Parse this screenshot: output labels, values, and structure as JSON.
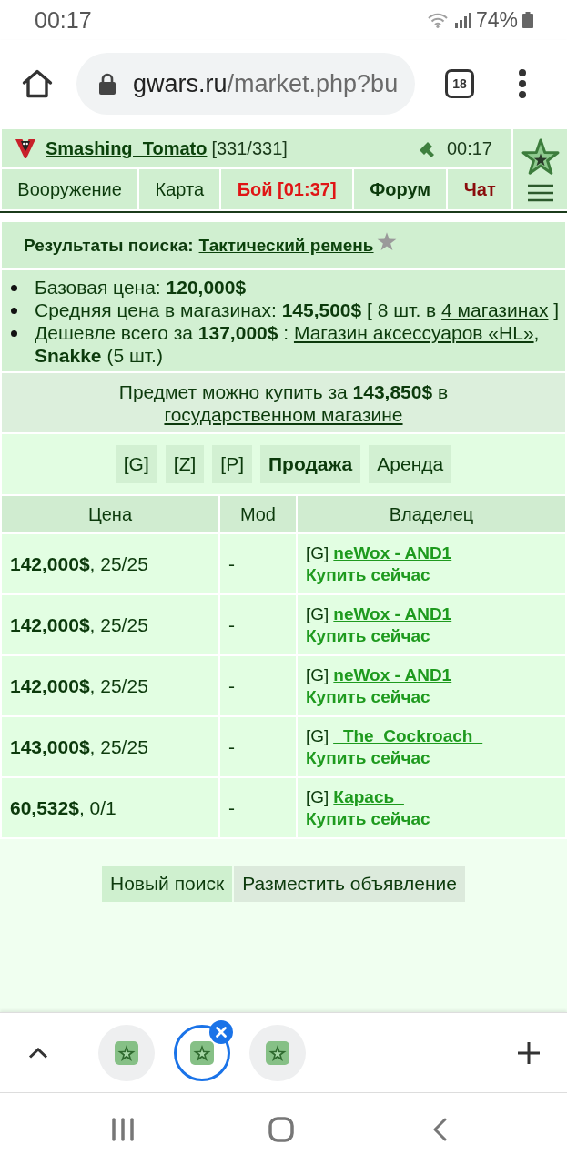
{
  "status_bar": {
    "time": "00:17",
    "battery": "74%"
  },
  "browser": {
    "url_host": "gwars.ru",
    "url_path": "/market.php?bu",
    "tab_count": "18"
  },
  "game_header": {
    "player": "Smashing_Tomato",
    "health": "[331/331]",
    "time": "00:17",
    "nav": [
      {
        "label": "Вооружение",
        "kind": "plain"
      },
      {
        "label": "Карта",
        "kind": "plain"
      },
      {
        "label": "Бой [01:37]",
        "kind": "battle"
      },
      {
        "label": "Форум",
        "kind": "bold"
      },
      {
        "label": "Чат",
        "kind": "chat"
      }
    ]
  },
  "search": {
    "label": "Результаты поиска:",
    "item": "Тактический ремень"
  },
  "info": [
    {
      "parts": [
        {
          "kind": "text",
          "text": "Базовая цена: **120,000$**"
        }
      ]
    },
    {
      "parts": [
        {
          "kind": "text",
          "text": "Средняя цена в магазинах: **145,500$** [ 8 шт. в "
        },
        {
          "kind": "link",
          "text": "4 магазинах"
        },
        {
          "kind": "text",
          "text": " ]"
        }
      ]
    },
    {
      "parts": [
        {
          "kind": "text",
          "text": "Дешевле всего за **137,000$** : "
        },
        {
          "kind": "link",
          "text": "Магазин аксессуаров «HL»"
        },
        {
          "kind": "text",
          "text": ", **Snakke** (5 шт.)"
        }
      ]
    }
  ],
  "offer": {
    "parts": [
      {
        "kind": "text",
        "text": "Предмет можно купить за **143,850$** в "
      },
      {
        "kind": "link",
        "text": "государственном магазине"
      }
    ]
  },
  "filters": [
    {
      "label": "[G]",
      "selected": false
    },
    {
      "label": "[Z]",
      "selected": false
    },
    {
      "label": "[P]",
      "selected": false
    },
    {
      "label": "Продажа",
      "selected": true
    },
    {
      "label": "Аренда",
      "selected": false
    }
  ],
  "table": {
    "columns": [
      "Цена",
      "Mod",
      "Владелец"
    ],
    "rows": [
      {
        "price": "**142,000$**, 25/25",
        "mod": "-",
        "owner_tag": "[G]",
        "owner": "neWox - AND1",
        "action": "Купить сейчас"
      },
      {
        "price": "**142,000$**, 25/25",
        "mod": "-",
        "owner_tag": "[G]",
        "owner": "neWox - AND1",
        "action": "Купить сейчас"
      },
      {
        "price": "**142,000$**, 25/25",
        "mod": "-",
        "owner_tag": "[G]",
        "owner": "neWox - AND1",
        "action": "Купить сейчас"
      },
      {
        "price": "**143,000$**, 25/25",
        "mod": "-",
        "owner_tag": "[G]",
        "owner": "_The_Cockroach_",
        "action": "Купить сейчас"
      },
      {
        "price": "**60,532$**, 0/1",
        "mod": "-",
        "owner_tag": "[G]",
        "owner": "Карась_",
        "action": "Купить сейчас"
      }
    ]
  },
  "actions": [
    {
      "label": "Новый поиск",
      "kind": "primary"
    },
    {
      "label": "Разместить объявление",
      "kind": "secondary"
    }
  ],
  "tab_strip": {
    "tabs": [
      {
        "selected": false
      },
      {
        "selected": true
      },
      {
        "selected": false
      }
    ]
  }
}
